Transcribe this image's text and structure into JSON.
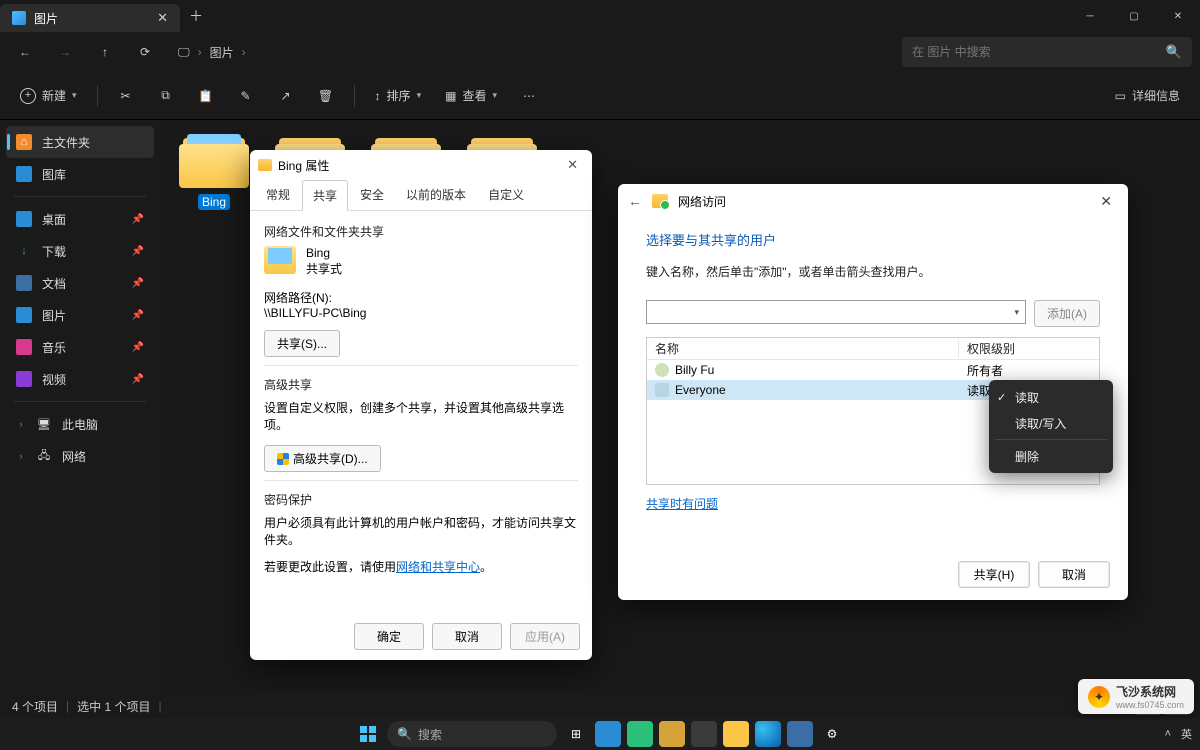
{
  "titlebar": {
    "tab_label": "图片"
  },
  "nav": {
    "breadcrumb": [
      "图片"
    ],
    "search_placeholder": "在 图片 中搜索"
  },
  "toolbar": {
    "new": "新建",
    "sort": "排序",
    "view": "查看",
    "details": "详细信息"
  },
  "sidebar": {
    "home": "主文件夹",
    "gallery": "图库",
    "desktop": "桌面",
    "downloads": "下载",
    "documents": "文档",
    "pictures": "图片",
    "music": "音乐",
    "videos": "视频",
    "thispc": "此电脑",
    "network": "网络"
  },
  "folders": [
    {
      "label": "Bing",
      "selected": true,
      "thumb": true
    },
    {
      "label": "",
      "selected": false,
      "thumb": false
    },
    {
      "label": "",
      "selected": false,
      "thumb": false
    },
    {
      "label": "",
      "selected": false,
      "thumb": false
    }
  ],
  "props": {
    "title": "Bing 属性",
    "tabs": {
      "general": "常规",
      "share": "共享",
      "security": "安全",
      "prev": "以前的版本",
      "custom": "自定义"
    },
    "section_net": "网络文件和文件夹共享",
    "name": "Bing",
    "state": "共享式",
    "path_label": "网络路径(N):",
    "path": "\\\\BILLYFU-PC\\Bing",
    "share_btn": "共享(S)...",
    "section_adv": "高级共享",
    "adv_desc": "设置自定义权限，创建多个共享，并设置其他高级共享选项。",
    "adv_btn": "高级共享(D)...",
    "section_pwd": "密码保护",
    "pwd_desc": "用户必须具有此计算机的用户帐户和密码，才能访问共享文件夹。",
    "pwd_change_prefix": "若要更改此设置，请使用",
    "pwd_link": "网络和共享中心",
    "ok": "确定",
    "cancel": "取消",
    "apply": "应用(A)"
  },
  "net": {
    "title": "网络访问",
    "heading": "选择要与其共享的用户",
    "desc": "键入名称，然后单击\"添加\"，或者单击箭头查找用户。",
    "add_btn": "添加(A)",
    "col_name": "名称",
    "col_perm": "权限级别",
    "rows": [
      {
        "name": "Billy Fu",
        "perm": "所有者",
        "dd": false
      },
      {
        "name": "Everyone",
        "perm": "读取",
        "dd": true,
        "sel": true
      }
    ],
    "ctx": {
      "read": "读取",
      "readwrite": "读取/写入",
      "remove": "删除"
    },
    "help_link": "共享时有问题",
    "share_btn": "共享(H)",
    "cancel_btn": "取消"
  },
  "status": {
    "count": "4 个项目",
    "sel": "选中 1 个项目"
  },
  "taskbar": {
    "search": "搜索",
    "lang": "英"
  },
  "watermark": {
    "name": "飞沙系统网",
    "url": "www.fs0745.com"
  }
}
